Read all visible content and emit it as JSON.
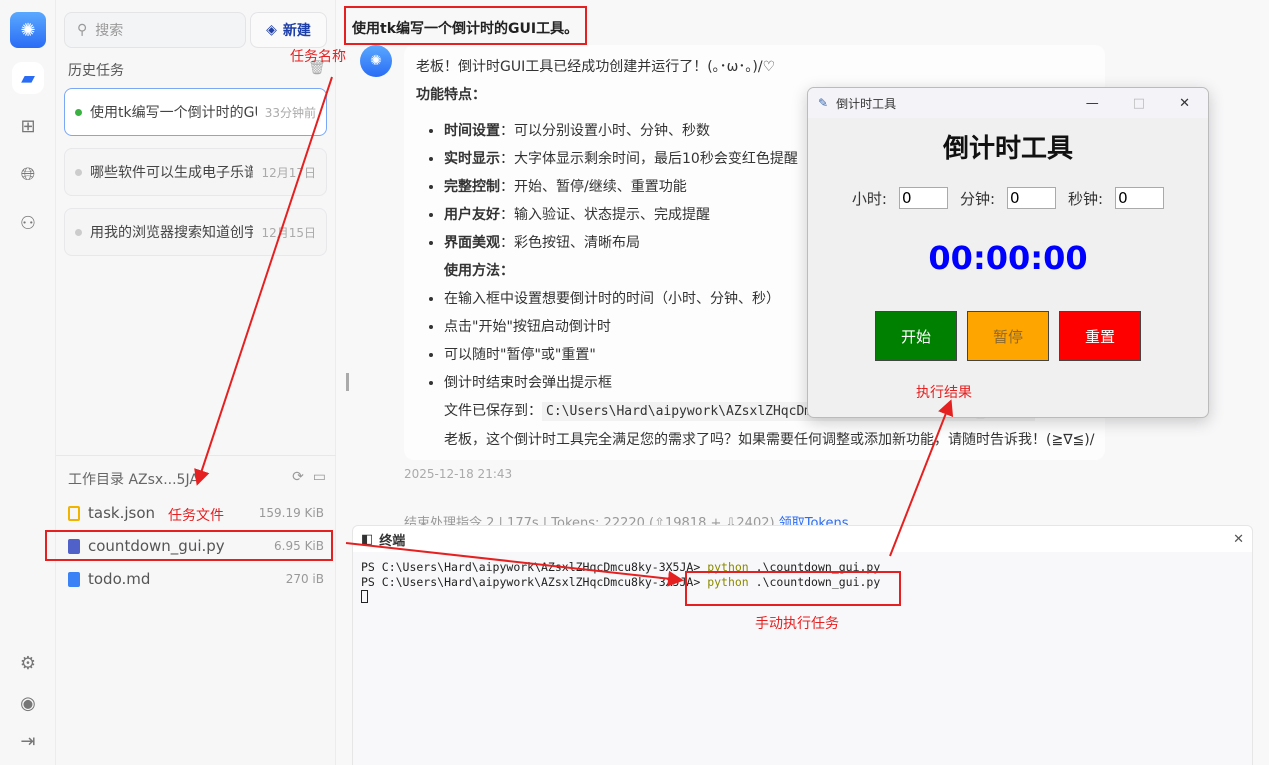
{
  "sidebar": {
    "search_placeholder": "搜索",
    "new_label": "新建",
    "history_label": "历史任务",
    "tasks": [
      {
        "title": "使用tk编写一个倒计时的GUI工具。",
        "time": "33分钟前"
      },
      {
        "title": "哪些软件可以生成电子乐谱",
        "time": "12月17日"
      },
      {
        "title": "用我的浏览器搜索知道创宇",
        "time": "12月15日"
      }
    ],
    "workdir_label": "工作目录 AZsx...5JA",
    "files": [
      {
        "name": "task.json",
        "size": "159.19 KiB"
      },
      {
        "name": "countdown_gui.py",
        "size": "6.95 KiB"
      },
      {
        "name": "todo.md",
        "size": "270 iB"
      }
    ]
  },
  "chat": {
    "user_message": "使用tk编写一个倒计时的GUI工具。",
    "intro": "老板！倒计时GUI工具已经成功创建并运行了！(｡･ω･｡)/♡",
    "features_title": "功能特点：",
    "features": [
      {
        "k": "时间设置",
        "v": "：可以分别设置小时、分钟、秒数"
      },
      {
        "k": "实时显示",
        "v": "：大字体显示剩余时间，最后10秒会变红色提醒"
      },
      {
        "k": "完整控制",
        "v": "：开始、暂停/继续、重置功能"
      },
      {
        "k": "用户友好",
        "v": "：输入验证、状态提示、完成提醒"
      },
      {
        "k": "界面美观",
        "v": "：彩色按钮、清晰布局"
      }
    ],
    "usage_title": "使用方法：",
    "usage": [
      "在输入框中设置想要倒计时的时间（小时、分钟、秒）",
      "点击\"开始\"按钮启动倒计时",
      "可以随时\"暂停\"或\"重置\"",
      "倒计时结束时会弹出提示框"
    ],
    "saved_label": "文件已保存到：",
    "saved_path": "C:\\Users\\Hard\\aipywork\\AZsxlZHqcDmcu8ky-3X5JA\\countdown_gui.py",
    "closing": "老板，这个倒计时工具完全满足您的需求了吗？如果需要任何调整或添加新功能，请随时告诉我！(≧∇≦)/",
    "timestamp": "2025-12-18 21:43",
    "stats": "结束处理指令 2 | 177s | Tokens: 22220 (⇧19818 + ⇩2402)",
    "stats_link": "领取Tokens"
  },
  "terminal": {
    "title": "终端",
    "prompt": "PS C:\\Users\\Hard\\aipywork\\AZsxlZHqcDmcu8ky-3X5JA> ",
    "cmd": "python",
    "arg": " .\\countdown_gui.py"
  },
  "tk": {
    "title": "倒计时工具",
    "heading": "倒计时工具",
    "hour_label": "小时:",
    "min_label": "分钟:",
    "sec_label": "秒钟:",
    "hour": "0",
    "min": "0",
    "sec": "0",
    "clock": "00:00:00",
    "start": "开始",
    "pause": "暂停",
    "reset": "重置"
  },
  "annotations": {
    "task_name": "任务名称",
    "task_file": "任务文件",
    "result": "执行结果",
    "manual": "手动执行任务"
  }
}
